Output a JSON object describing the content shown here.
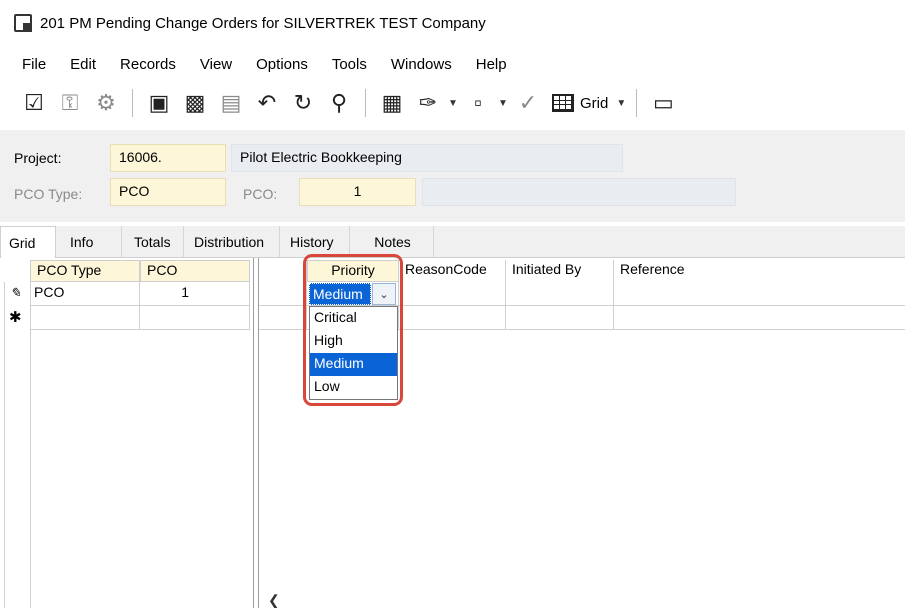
{
  "window": {
    "title": "201 PM Pending Change Orders for SILVERTREK TEST Company"
  },
  "menu": [
    "File",
    "Edit",
    "Records",
    "View",
    "Options",
    "Tools",
    "Windows",
    "Help"
  ],
  "toolbar": {
    "grid_label": "Grid"
  },
  "form": {
    "project_label": "Project:",
    "project_value": "16006.",
    "project_name": "Pilot Electric Bookkeeping",
    "pco_type_label": "PCO Type:",
    "pco_type_value": "PCO",
    "pco_label": "PCO:",
    "pco_value": "1",
    "pco_desc": ""
  },
  "tabs": [
    "Grid",
    "Info",
    "Totals",
    "Distribution",
    "History",
    "Notes"
  ],
  "left_grid": {
    "columns": [
      "PCO Type",
      "PCO"
    ],
    "rows": [
      {
        "pco_type": "PCO",
        "pco": "1"
      }
    ]
  },
  "right_grid": {
    "columns": [
      "Priority",
      "ReasonCode",
      "Initiated By",
      "Reference"
    ],
    "priority_value": "Medium"
  },
  "priority_options": [
    "Critical",
    "High",
    "Medium",
    "Low"
  ],
  "colors": {
    "accent_highlight": "#d9473a",
    "selection": "#0a64d6",
    "required_field": "#fdf6d8"
  }
}
